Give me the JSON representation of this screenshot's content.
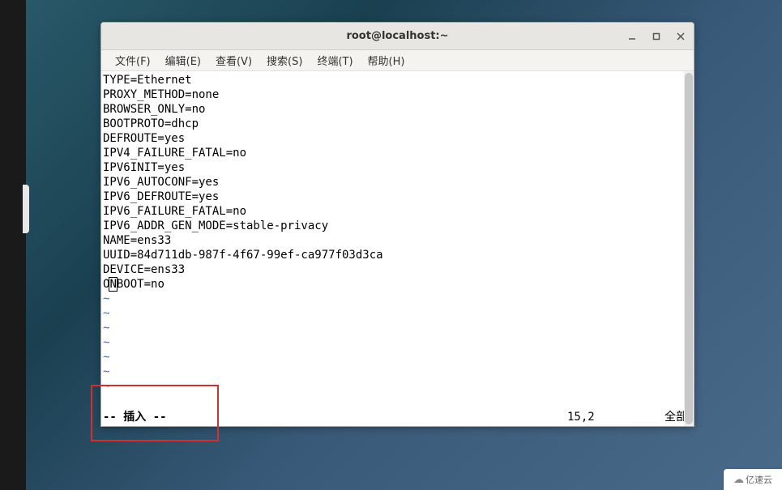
{
  "window": {
    "title": "root@localhost:~"
  },
  "menubar": {
    "items": [
      "文件(F)",
      "编辑(E)",
      "查看(V)",
      "搜索(S)",
      "终端(T)",
      "帮助(H)"
    ]
  },
  "editor": {
    "lines": [
      "TYPE=Ethernet",
      "PROXY_METHOD=none",
      "BROWSER_ONLY=no",
      "BOOTPROTO=dhcp",
      "DEFROUTE=yes",
      "IPV4_FAILURE_FATAL=no",
      "IPV6INIT=yes",
      "IPV6_AUTOCONF=yes",
      "IPV6_DEFROUTE=yes",
      "IPV6_FAILURE_FATAL=no",
      "IPV6_ADDR_GEN_MODE=stable-privacy",
      "NAME=ens33",
      "UUID=84d711db-987f-4f67-99ef-ca977f03d3ca",
      "DEVICE=ens33"
    ],
    "cursor_line_prefix": "O",
    "cursor_char": "N",
    "cursor_line_suffix": "BOOT=no",
    "tilde_count": 7
  },
  "status": {
    "mode": "-- 插入 --",
    "position": "15,2",
    "percent": "全部"
  },
  "watermark": {
    "text": "亿速云"
  }
}
